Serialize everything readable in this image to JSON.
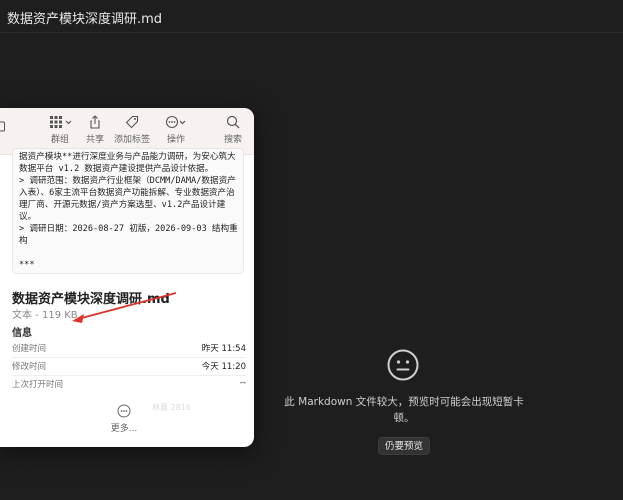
{
  "window": {
    "title": "数据资产模块深度调研.md"
  },
  "toolbar": {
    "group_label": "群组",
    "share_label": "共享",
    "tag_label": "添加标签",
    "action_label": "操作",
    "search_label": "搜索"
  },
  "preview": {
    "lines": [
      "据资产模块**进行深度业务与产品能力调研，为安心筑大",
      "数据平台 v1.2 数据资产建设提供产品设计依据。",
      "> 调研范围：数据资产行业框架（DCMM/DAMA/数据资产",
      "入表）、6家主流平台数据资产功能拆解、专业数据资产治",
      "理厂商、开源元数据/资产方案选型、v1.2产品设计建",
      "议。",
      "> 调研日期：2026-08-27 初版，2026-09-03 结构重",
      "构",
      "",
      "***"
    ]
  },
  "file": {
    "name": "数据资产模块深度调研.md",
    "meta": "文本 - 119 KB"
  },
  "info": {
    "heading": "信息",
    "created_label": "创建时间",
    "created_value": "昨天 11:54",
    "modified_label": "修改时间",
    "modified_value": "今天 11:20",
    "opened_label": "上次打开时间",
    "opened_value": "--"
  },
  "more_label": "更多...",
  "watermark": "林晨 2816",
  "message": {
    "text": "此 Markdown 文件较大，预览时可能会出现短暂卡顿。",
    "button": "仍要预览"
  },
  "colors": {
    "arrow": "#e0312b",
    "background": "#1e1e1e"
  }
}
